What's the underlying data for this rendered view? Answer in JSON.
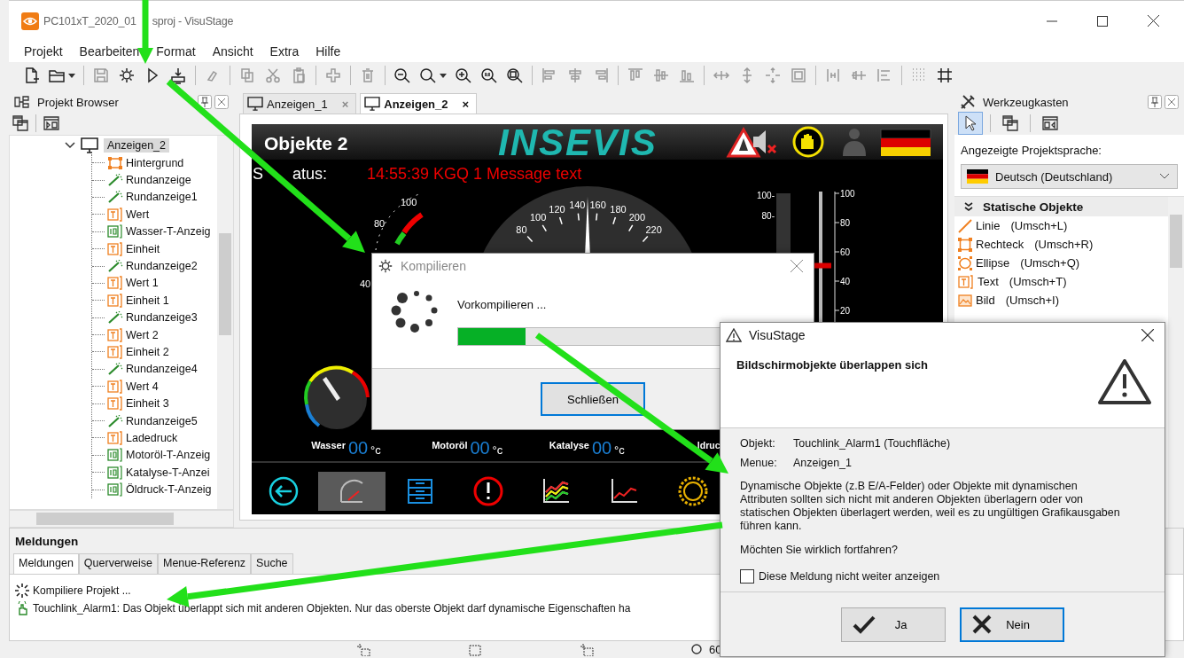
{
  "window": {
    "title_start": "PC101xT_2020_01",
    "title_end": "sproj - VisuStage"
  },
  "menu": [
    "Projekt",
    "Bearbeiten",
    "Format",
    "Ansicht",
    "Extra",
    "Hilfe"
  ],
  "project_browser": {
    "title": "Projekt Browser",
    "root": {
      "label": "Anzeigen_2",
      "expanded": true,
      "selected": true,
      "children": [
        {
          "label": "Hintergrund",
          "kind": "rect"
        },
        {
          "label": "Rundanzeige",
          "kind": "gauge"
        },
        {
          "label": "Rundanzeige1",
          "kind": "gauge"
        },
        {
          "label": "Wert",
          "kind": "text"
        },
        {
          "label": "Wasser-T-Anzeig",
          "kind": "numeric"
        },
        {
          "label": "Einheit",
          "kind": "text"
        },
        {
          "label": "Rundanzeige2",
          "kind": "gauge"
        },
        {
          "label": "Wert 1",
          "kind": "text"
        },
        {
          "label": "Einheit 1",
          "kind": "text"
        },
        {
          "label": "Rundanzeige3",
          "kind": "gauge"
        },
        {
          "label": "Wert 2",
          "kind": "text"
        },
        {
          "label": "Einheit 2",
          "kind": "text"
        },
        {
          "label": "Rundanzeige4",
          "kind": "gauge"
        },
        {
          "label": "Wert 4",
          "kind": "text"
        },
        {
          "label": "Einheit 3",
          "kind": "text"
        },
        {
          "label": "Rundanzeige5",
          "kind": "gauge"
        },
        {
          "label": "Ladedruck",
          "kind": "text"
        },
        {
          "label": "Motoröl-T-Anzeig",
          "kind": "numeric"
        },
        {
          "label": "Katalyse-T-Anzei",
          "kind": "numeric"
        },
        {
          "label": "Öldruck-T-Anzeig",
          "kind": "numeric"
        }
      ]
    }
  },
  "tabs": [
    {
      "label": "Anzeigen_1",
      "selected": false,
      "close": "×"
    },
    {
      "label": "Anzeigen_2",
      "selected": true,
      "close": "×"
    }
  ],
  "hmi": {
    "title": "Objekte 2",
    "logo": "INSEVIS",
    "status_label_parts": [
      "S",
      "atus:"
    ],
    "status_message": "14:55:39 KGQ 1 Message text",
    "small_gauge_ticks": [
      "100",
      "80",
      "40"
    ],
    "speedometer_ticks": [
      "80",
      "100",
      "120",
      "140",
      "160",
      "180",
      "200",
      "220"
    ],
    "bar_ticks": [
      "100-",
      "80-"
    ],
    "slider_ticks": [
      "100",
      "80",
      "60",
      "40",
      "20"
    ],
    "slider": {
      "level": 0.52
    },
    "readouts": [
      {
        "label": "Wasser",
        "value": "00",
        "unit": "°c"
      },
      {
        "label": "Motoröl",
        "value": "00",
        "unit": "°c"
      },
      {
        "label": "Katalyse",
        "value": "00",
        "unit": "°c"
      },
      {
        "label": "ldruc"
      }
    ],
    "nav": [
      {
        "kind": "back",
        "selected": false
      },
      {
        "kind": "gauge",
        "selected": true
      },
      {
        "kind": "list",
        "selected": false
      },
      {
        "kind": "alarm",
        "selected": false
      },
      {
        "kind": "multi-chart",
        "selected": false
      },
      {
        "kind": "chart",
        "selected": false
      },
      {
        "kind": "settings",
        "selected": false
      }
    ]
  },
  "toolbox": {
    "title": "Werkzeugkasten",
    "tools": [
      {
        "kind": "pointer",
        "selected": true
      },
      {
        "kind": "windows",
        "selected": false
      },
      {
        "kind": "panel",
        "selected": false
      }
    ],
    "language_label": "Angezeigte Projektsprache:",
    "language": "Deutsch (Deutschland)",
    "section": {
      "title": "Statische Objekte",
      "expanded": true,
      "items": [
        {
          "kind": "line",
          "name": "Linie",
          "shortcut": "(Umsch+L)"
        },
        {
          "kind": "rect",
          "name": "Rechteck",
          "shortcut": "(Umsch+R)"
        },
        {
          "kind": "ellipse",
          "name": "Ellipse",
          "shortcut": "(Umsch+Q)"
        },
        {
          "kind": "text",
          "name": "Text",
          "shortcut": "(Umsch+T)"
        },
        {
          "kind": "image",
          "name": "Bild",
          "shortcut": "(Umsch+I)"
        }
      ]
    }
  },
  "messages": {
    "title": "Meldungen",
    "tabs": [
      {
        "label": "Meldungen",
        "selected": true
      },
      {
        "label": "Querverweise",
        "selected": false
      },
      {
        "label": "Menue-Referenz",
        "selected": false
      },
      {
        "label": "Suche",
        "selected": false
      }
    ],
    "lines": [
      {
        "kind": "progress",
        "text": "Kompiliere Projekt ..."
      },
      {
        "kind": "touch",
        "text": "Touchlink_Alarm1: Das Objekt überlappt sich mit anderen Objekten. Nur das oberste Objekt darf dynamische Eigenschaften ha"
      }
    ]
  },
  "status_bar": {
    "zoom": "60"
  },
  "compile_dialog": {
    "title": "Kompilieren",
    "status": "Vorkompilieren ...",
    "level": 0.2,
    "button": {
      "label": "Schließen",
      "focused": true
    }
  },
  "warning_dialog": {
    "title": "VisuStage",
    "heading": "Bildschirmobjekte überlappen sich",
    "fields": [
      {
        "label": "Objekt:",
        "value": "Touchlink_Alarm1 (Touchfläche)"
      },
      {
        "label": "Menue:",
        "value": "Anzeigen_1"
      }
    ],
    "message": "Dynamische Objekte (z.B E/A-Felder) oder Objekte mit dynamischen Attributen sollten sich nicht mit anderen Objekten überlagern oder von statischen Objekten überlagert werden, weil es zu ungültigen Grafikausgaben führen kann.",
    "question": "Möchten Sie wirklich fortfahren?",
    "checkbox": {
      "label": "Diese Meldung nicht weiter anzeigen",
      "checked": false
    },
    "buttons": [
      {
        "kind": "yes",
        "label": "Ja",
        "focused": false
      },
      {
        "kind": "no",
        "label": "Nein",
        "focused": true
      }
    ]
  }
}
